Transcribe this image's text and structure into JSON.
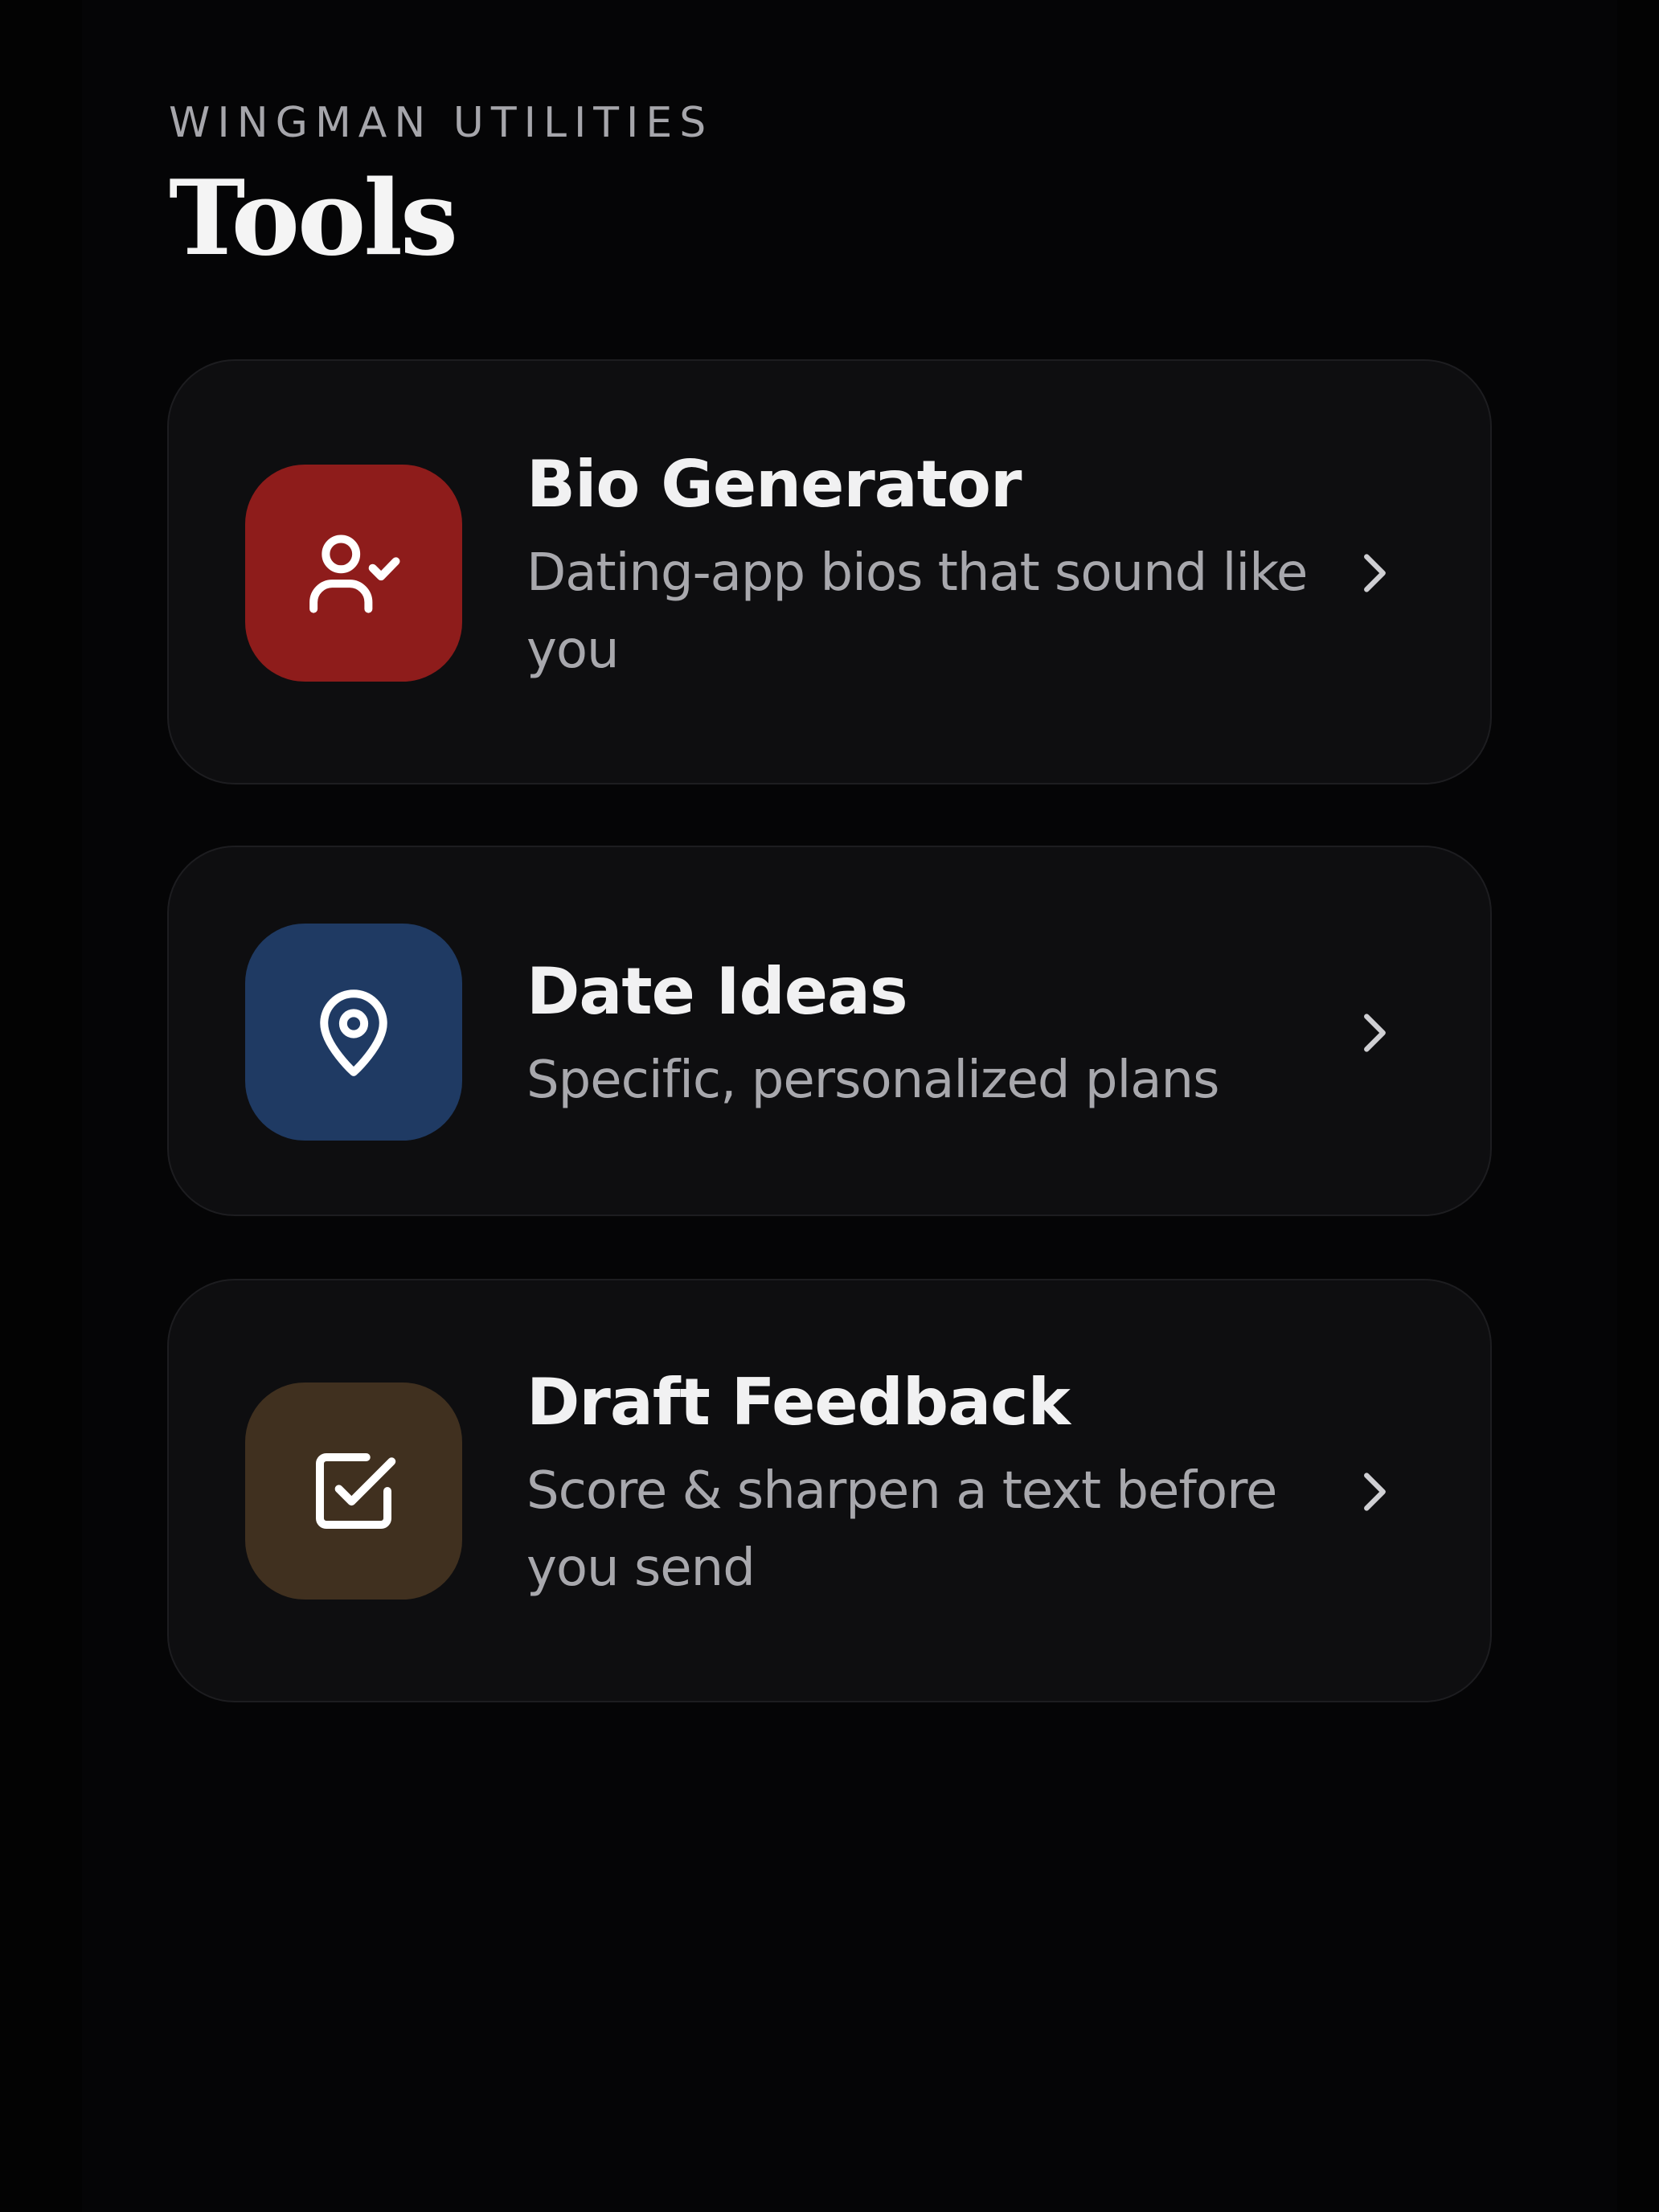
{
  "header": {
    "eyebrow": "WINGMAN UTILITIES",
    "title": "Tools"
  },
  "tools": [
    {
      "title": "Bio Generator",
      "description": "Dating-app bios that sound like you",
      "icon": "user-check-icon",
      "tile_color": "#8e1c1b"
    },
    {
      "title": "Date Ideas",
      "description": "Specific, personalized plans",
      "icon": "map-pin-icon",
      "tile_color": "#1f3a63"
    },
    {
      "title": "Draft Feedback",
      "description": "Score & sharpen a text before you send",
      "icon": "checkbox-icon",
      "tile_color": "#40301f"
    }
  ],
  "colors": {
    "background": "#050506",
    "card": "#0e0e10",
    "text_primary": "#f1f1f2",
    "text_secondary": "#a8a8ad"
  }
}
